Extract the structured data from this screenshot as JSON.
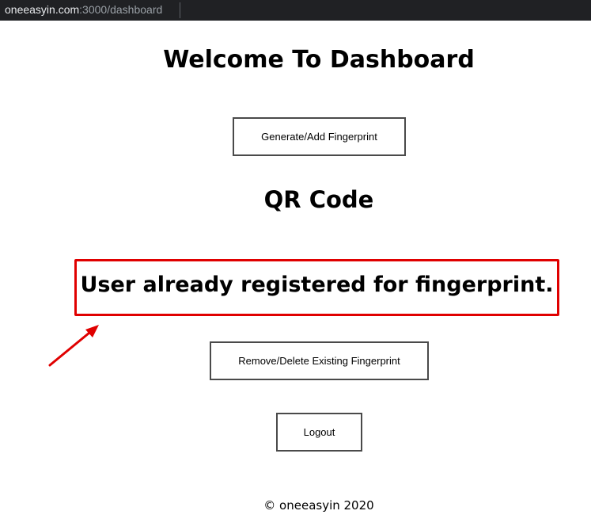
{
  "browser": {
    "url_host": "oneeasyin.com",
    "url_rest": ":3000/dashboard"
  },
  "dashboard": {
    "title": "Welcome To Dashboard",
    "generate_button": "Generate/Add Fingerprint",
    "qr_heading": "QR Code",
    "status_message": "User already registered for fingerprint.",
    "remove_button": "Remove/Delete Existing Fingerprint",
    "logout_button": "Logout"
  },
  "footer": {
    "copyright": "© oneeasyin 2020"
  },
  "annotation": {
    "highlight_color": "#e00000",
    "arrow_icon": "arrow-up-right-icon"
  }
}
